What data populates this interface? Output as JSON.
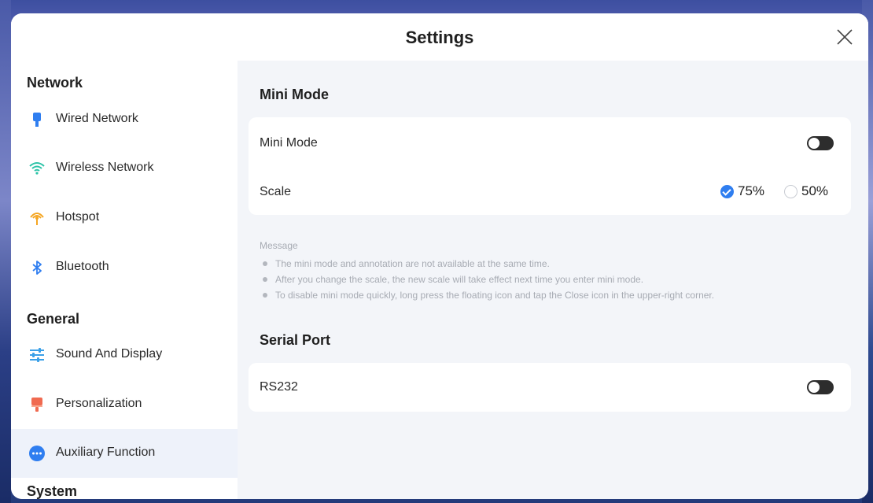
{
  "dialog": {
    "title": "Settings"
  },
  "sidebar": {
    "sections": [
      {
        "title": "Network"
      },
      {
        "title": "General"
      },
      {
        "title": "System"
      }
    ],
    "items": [
      {
        "label": "Wired Network",
        "icon": "ethernet-icon",
        "color": "#2f7ef0"
      },
      {
        "label": "Wireless Network",
        "icon": "wifi-icon",
        "color": "#2ec4a8"
      },
      {
        "label": "Hotspot",
        "icon": "hotspot-icon",
        "color": "#f5a623"
      },
      {
        "label": "Bluetooth",
        "icon": "bluetooth-icon",
        "color": "#2f7ef0"
      },
      {
        "label": "Sound And Display",
        "icon": "sliders-icon",
        "color": "#3aa0e8"
      },
      {
        "label": "Personalization",
        "icon": "brush-icon",
        "color": "#f06a50"
      },
      {
        "label": "Auxiliary Function",
        "icon": "more-icon",
        "color": "#2f7ef0",
        "active": true
      }
    ]
  },
  "main": {
    "mini_mode": {
      "section_title": "Mini Mode",
      "toggle_label": "Mini Mode",
      "toggle_on": false,
      "scale_label": "Scale",
      "scale_options": [
        {
          "label": "75%",
          "selected": true
        },
        {
          "label": "50%",
          "selected": false
        }
      ]
    },
    "message": {
      "title": "Message",
      "items": [
        "The mini mode and annotation are not available at the same time.",
        "After you change the scale, the new scale will take effect next time you enter mini mode.",
        "To disable mini mode quickly, long press the floating icon and tap the Close icon in the upper-right corner."
      ]
    },
    "serial_port": {
      "section_title": "Serial Port",
      "toggle_label": "RS232",
      "toggle_on": false
    }
  },
  "colors": {
    "accent": "#2f7ef0",
    "active_item_bg": "#eef2fa",
    "content_bg": "#f3f5f9",
    "toggle_off": "#2d2d2d"
  }
}
